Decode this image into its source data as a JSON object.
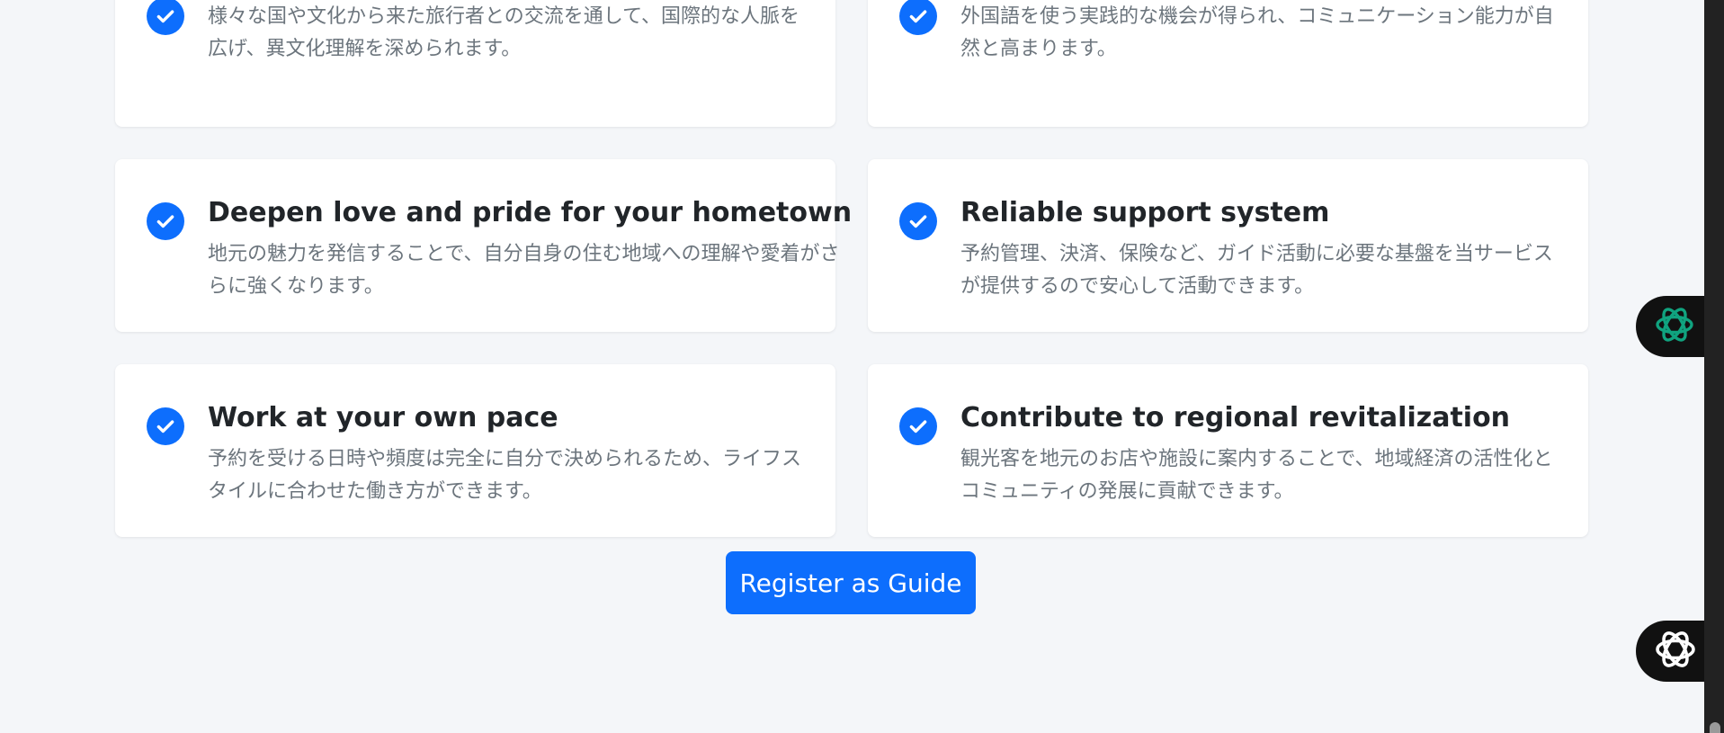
{
  "benefits": [
    {
      "title": "",
      "description": "様々な国や文化から来た旅行者との交流を通して、国際的な人脈を広げ、異文化理解を深められます。"
    },
    {
      "title": "",
      "description": "外国語を使う実践的な機会が得られ、コミュニケーション能力が自然と高まります。"
    },
    {
      "title": "Deepen love and pride for your hometown",
      "description": "地元の魅力を発信することで、自分自身の住む地域への理解や愛着がさらに強くなります。"
    },
    {
      "title": "Reliable support system",
      "description": "予約管理、決済、保険など、ガイド活動に必要な基盤を当サービスが提供するので安心して活動できます。"
    },
    {
      "title": "Work at your own pace",
      "description": "予約を受ける日時や頻度は完全に自分で決められるため、ライフスタイルに合わせた働き方ができます。"
    },
    {
      "title": "Contribute to regional revitalization",
      "description": "観光客を地元のお店や施設に案内することで、地域経済の活性化とコミュニティの発展に貢献できます。"
    }
  ],
  "register_button": {
    "label": "Register as Guide"
  },
  "icons": {
    "check": "check-circle-icon",
    "floating_1": "chatgpt-icon",
    "floating_2": "openai-icon"
  },
  "colors": {
    "accent": "#0d6efd",
    "floating_1_icon": "#10a37f",
    "floating_2_icon": "#ffffff",
    "background": "#f4f6f9"
  }
}
